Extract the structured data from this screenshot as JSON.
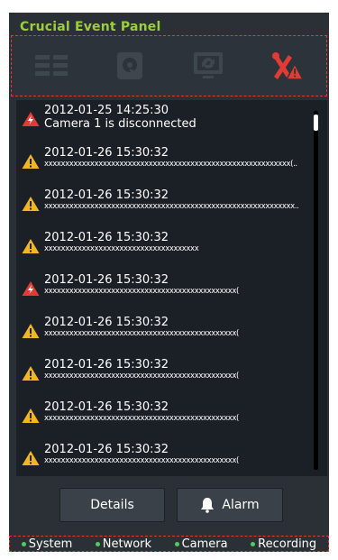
{
  "panel": {
    "title": "Crucial Event Panel"
  },
  "toolbar": {
    "icons": [
      "grid-view-icon",
      "disk-icon",
      "monitor-refresh-icon",
      "tools-alert-icon"
    ],
    "active_color": "#e23b33",
    "inactive_color": "#3e464e"
  },
  "events": [
    {
      "type": "error",
      "time": "2012-01-25  14:25:30",
      "message": "Camera 1 is disconnected"
    },
    {
      "type": "warning",
      "time": "2012-01-26  15:30:32",
      "message": "xxxxxxxxxxxxxxxxxxxxxxxxxxxxxxxxxxxxxxxxxxxxxxxxxxxxxxxxxxx(.."
    },
    {
      "type": "warning",
      "time": "2012-01-26  15:30:32",
      "message": "xxxxxxxxxxxxxxxxxxxxxxxxxxxxxxxxxxxxxxxxxxxxxxxxxxxxxxxxxxxx.."
    },
    {
      "type": "warning",
      "time": "2012-01-26  15:30:32",
      "message": "xxxxxxxxxxxxxxxxxxxxxxxxxxxxxxxxxxxxx"
    },
    {
      "type": "error",
      "time": "2012-01-26  15:30:32",
      "message": "xxxxxxxxxxxxxxxxxxxxxxxxxxxxxxxxxxxxxxxxxxxxxx("
    },
    {
      "type": "warning",
      "time": "2012-01-26  15:30:32",
      "message": "xxxxxxxxxxxxxxxxxxxxxxxxxxxxxxxxxxxxxxxxxxxxxx("
    },
    {
      "type": "warning",
      "time": "2012-01-26  15:30:32",
      "message": "xxxxxxxxxxxxxxxxxxxxxxxxxxxxxxxxxxxxxxxxxxxxxx("
    },
    {
      "type": "warning",
      "time": "2012-01-26  15:30:32",
      "message": "xxxxxxxxxxxxxxxxxxxxxxxxxxxxxxxxxxxxxxxxxxxxxx("
    },
    {
      "type": "warning",
      "time": "2012-01-26  15:30:32",
      "message": "xxxxxxxxxxxxxxxxxxxxxxxxxxxxxxxxxxxxxxxxxxxxxx("
    }
  ],
  "buttons": {
    "details": "Details",
    "alarm": "Alarm"
  },
  "status": [
    {
      "label": "System"
    },
    {
      "label": "Network"
    },
    {
      "label": "Camera"
    },
    {
      "label": "Recording"
    }
  ],
  "colors": {
    "title": "#9ccf3c",
    "status_dot": "#49d15a",
    "warning": "#f2b620",
    "error": "#e23b33"
  }
}
